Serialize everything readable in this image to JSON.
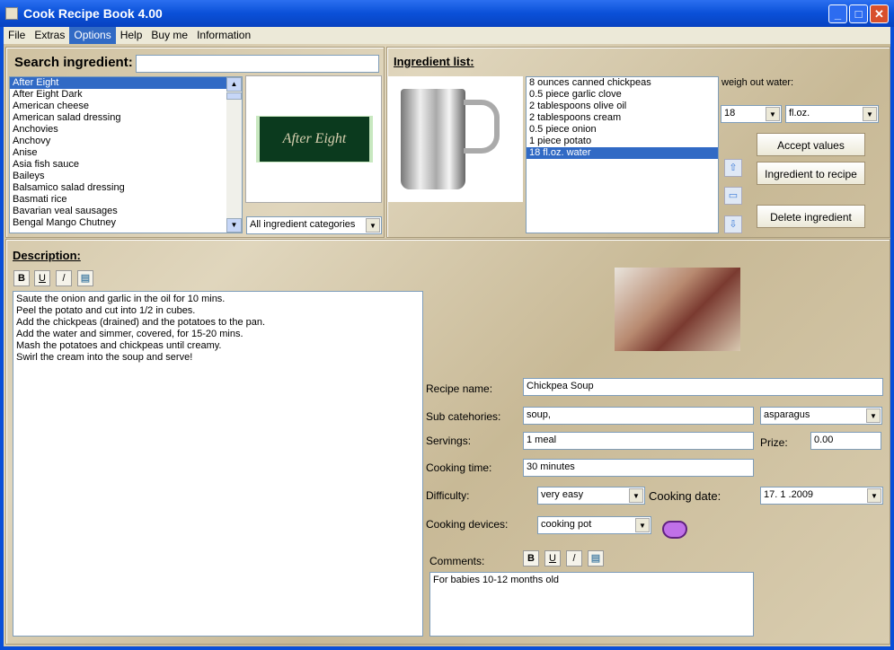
{
  "window": {
    "title": "Cook Recipe Book 4.00"
  },
  "menu": [
    "File",
    "Extras",
    "Options",
    "Help",
    "Buy me",
    "Information"
  ],
  "search": {
    "label": "Search ingredient:",
    "value": ""
  },
  "ingredients": [
    "After Eight",
    "After Eight Dark",
    "American cheese",
    "American salad dressing",
    "Anchovies",
    "Anchovy",
    "Anise",
    "Asia fish sauce",
    "Baileys",
    "Balsamico salad dressing",
    "Basmati rice",
    "Bavarian veal sausages",
    "Bengal Mango Chutney"
  ],
  "ingredient_image_text": "After Eight",
  "category_select": "All ingredient categories",
  "ingredient_list": {
    "title": "Ingredient list:",
    "items": [
      "8 ounces canned chickpeas",
      "0.5 piece garlic clove",
      "2 tablespoons olive oil",
      "2 tablespoons cream",
      "0.5 piece onion",
      "1 piece potato",
      "18 fl.oz. water"
    ],
    "selected": 6
  },
  "weigh": {
    "label": "weigh out water:",
    "amount": "18",
    "unit": "fl.oz."
  },
  "buttons": {
    "accept": "Accept values",
    "to_recipe": "Ingredient to recipe",
    "delete": "Delete ingredient"
  },
  "format": {
    "bold": "B",
    "underline": "U",
    "italic": "/"
  },
  "description": {
    "title": "Description:",
    "lines": [
      "Saute the onion and garlic in the oil for 10 mins.",
      "Peel the potato and cut into 1/2 in cubes.",
      "Add the chickpeas (drained) and the potatoes to the pan.",
      "Add the water and simmer, covered, for 15-20 mins.",
      "Mash the potatoes and chickpeas until creamy.",
      "Swirl the cream into the soup and serve!"
    ]
  },
  "form": {
    "recipe_name_label": "Recipe name:",
    "recipe_name": "Chickpea Soup",
    "sub_label": "Sub catehories:",
    "sub_value": "soup,",
    "sub_select": "asparagus",
    "servings_label": "Servings:",
    "servings": "1 meal",
    "prize_label": "Prize:",
    "prize": "0.00",
    "time_label": "Cooking time:",
    "time": "30 minutes",
    "difficulty_label": "Difficulty:",
    "difficulty": "very easy",
    "date_label": "Cooking date:",
    "date": "17. 1 .2009",
    "devices_label": "Cooking devices:",
    "device": "cooking pot",
    "comments_label": "Comments:",
    "comments": "For babies 10-12 months old"
  }
}
